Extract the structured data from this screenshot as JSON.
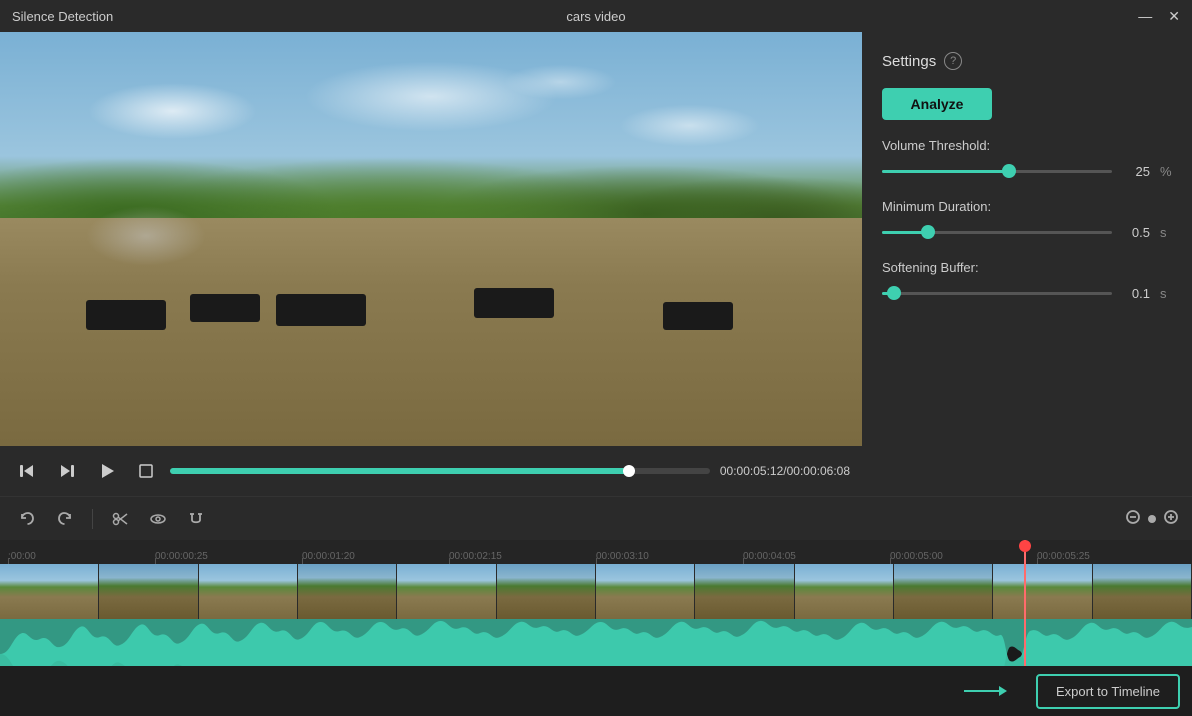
{
  "titlebar": {
    "title_left": "Silence Detection",
    "title_center": "cars video",
    "minimize_label": "—",
    "close_label": "✕"
  },
  "settings": {
    "title": "Settings",
    "help_icon": "?",
    "analyze_label": "Analyze",
    "volume_threshold": {
      "label": "Volume Threshold:",
      "value": 25,
      "unit": "%",
      "fill_pct": 55
    },
    "minimum_duration": {
      "label": "Minimum Duration:",
      "value": "0.5",
      "unit": "s",
      "fill_pct": 20
    },
    "softening_buffer": {
      "label": "Softening Buffer:",
      "value": "0.1",
      "unit": "s",
      "fill_pct": 5
    }
  },
  "video_controls": {
    "time_current": "00:00:05:12",
    "time_total": "00:00:06:08",
    "time_display": "00:00:05:12/00:00:06:08",
    "progress_pct": 85
  },
  "timeline_toolbar": {
    "undo_label": "↺",
    "redo_label": "↻",
    "scissors_label": "✂",
    "eye_label": "◉",
    "magnet_label": "⊕"
  },
  "timeline_ruler": {
    "marks": [
      ":00:00",
      "00:00:00:25",
      "00:00:01:20",
      "00:00:02:15",
      "00:00:03:10",
      "00:00:04:05",
      "00:00:05:00",
      "00:00:05:25"
    ]
  },
  "playhead": {
    "position_pct": 86
  },
  "export": {
    "label": "Export to Timeline"
  }
}
